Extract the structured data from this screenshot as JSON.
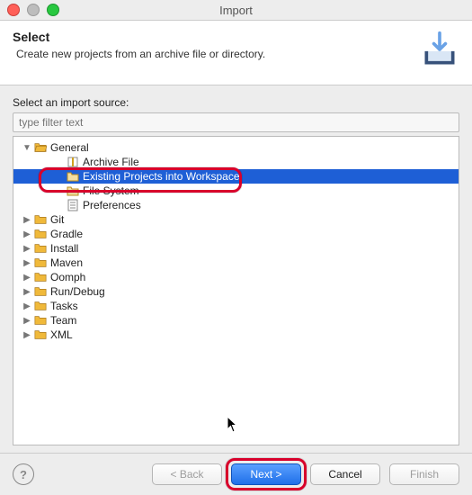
{
  "window": {
    "title": "Import"
  },
  "header": {
    "heading": "Select",
    "subtext": "Create new projects from an archive file or directory."
  },
  "body": {
    "label": "Select an import source:",
    "filter_placeholder": "type filter text"
  },
  "tree": [
    {
      "label": "General",
      "depth": 0,
      "expanded": true,
      "type": "folder",
      "children": [
        {
          "label": "Archive File",
          "type": "file-archive"
        },
        {
          "label": "Existing Projects into Workspace",
          "type": "file-folder",
          "selected": true,
          "highlighted": true
        },
        {
          "label": "File System",
          "type": "file-folder"
        },
        {
          "label": "Preferences",
          "type": "file-pref"
        }
      ]
    },
    {
      "label": "Git",
      "depth": 0,
      "expanded": false,
      "type": "folder",
      "children": []
    },
    {
      "label": "Gradle",
      "depth": 0,
      "expanded": false,
      "type": "folder",
      "children": []
    },
    {
      "label": "Install",
      "depth": 0,
      "expanded": false,
      "type": "folder",
      "children": []
    },
    {
      "label": "Maven",
      "depth": 0,
      "expanded": false,
      "type": "folder",
      "children": []
    },
    {
      "label": "Oomph",
      "depth": 0,
      "expanded": false,
      "type": "folder",
      "children": []
    },
    {
      "label": "Run/Debug",
      "depth": 0,
      "expanded": false,
      "type": "folder",
      "children": []
    },
    {
      "label": "Tasks",
      "depth": 0,
      "expanded": false,
      "type": "folder",
      "children": []
    },
    {
      "label": "Team",
      "depth": 0,
      "expanded": false,
      "type": "folder",
      "children": []
    },
    {
      "label": "XML",
      "depth": 0,
      "expanded": false,
      "type": "folder",
      "children": []
    }
  ],
  "footer": {
    "back": "< Back",
    "next": "Next >",
    "cancel": "Cancel",
    "finish": "Finish"
  },
  "icons": {
    "folder_color": "#f0b93a",
    "folder_outline": "#a9791e"
  }
}
